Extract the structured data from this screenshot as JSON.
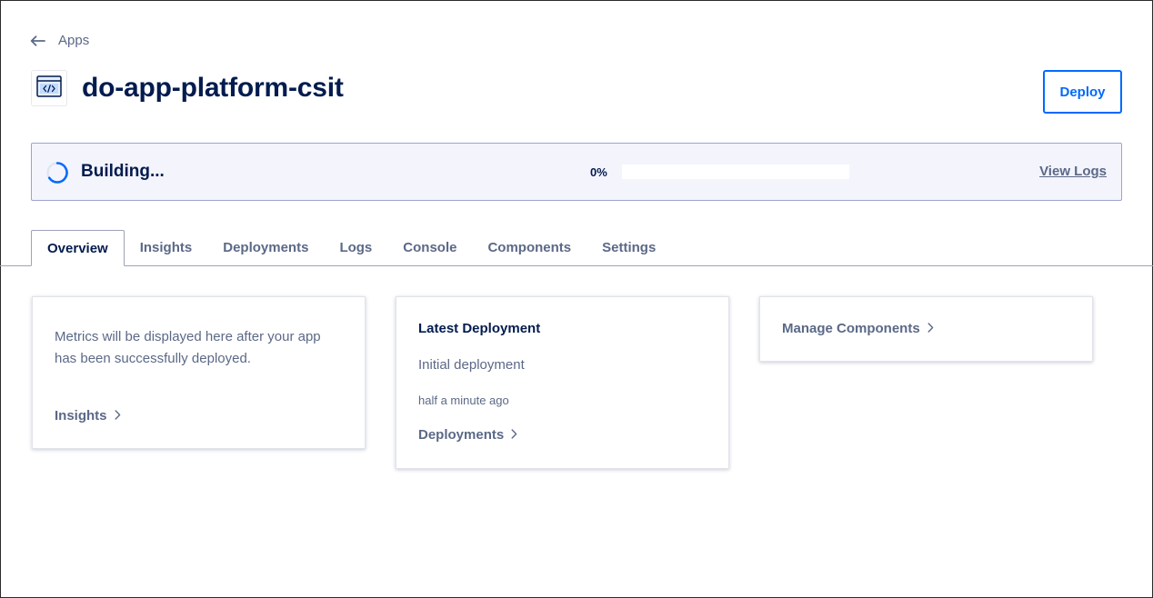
{
  "breadcrumb": {
    "icon": "arrow-left-icon",
    "label": "Apps"
  },
  "app": {
    "icon": "code-window-icon",
    "title": "do-app-platform-csit"
  },
  "header": {
    "deploy_label": "Deploy"
  },
  "status": {
    "icon": "spinner-icon",
    "text": "Building...",
    "progress_percent": 0,
    "progress_label": "0%",
    "view_logs_label": "View Logs"
  },
  "tabs": [
    {
      "label": "Overview",
      "active": true
    },
    {
      "label": "Insights",
      "active": false
    },
    {
      "label": "Deployments",
      "active": false
    },
    {
      "label": "Logs",
      "active": false
    },
    {
      "label": "Console",
      "active": false
    },
    {
      "label": "Components",
      "active": false
    },
    {
      "label": "Settings",
      "active": false
    }
  ],
  "cards": {
    "metrics": {
      "text": "Metrics will be displayed here after your app has been successfully deployed.",
      "link_label": "Insights"
    },
    "latest_deployment": {
      "heading": "Latest Deployment",
      "name": "Initial deployment",
      "time": "half a minute ago",
      "link_label": "Deployments"
    },
    "manage": {
      "link_label": "Manage Components"
    }
  },
  "colors": {
    "accent": "#0069ff",
    "heading": "#031b4e",
    "muted": "#5b6987",
    "banner_bg": "#f4f4fd",
    "banner_border": "#9ea3d1"
  }
}
